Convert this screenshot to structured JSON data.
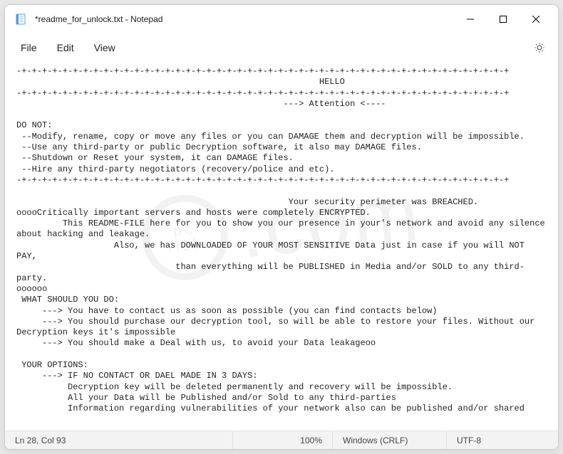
{
  "titlebar": {
    "title": "*readme_for_unlock.txt - Notepad"
  },
  "menu": {
    "file": "File",
    "edit": "Edit",
    "view": "View"
  },
  "status": {
    "pos": "Ln 28, Col 93",
    "zoom": "100%",
    "crlf": "Windows (CRLF)",
    "enc": "UTF-8"
  },
  "content": "-+-+-+-+-+-+-+-+-+-+-+-+-+-+-+-+-+-+-+-+-+-+-+-+-+-+-+-+-+-+-+-+-+-+-+-+-+-+-+-+-+-+-+-+-+-+-+-+\n                                                           HELLO\n-+-+-+-+-+-+-+-+-+-+-+-+-+-+-+-+-+-+-+-+-+-+-+-+-+-+-+-+-+-+-+-+-+-+-+-+-+-+-+-+-+-+-+-+-+-+-+-+\n                                                    ---> Attention <----\n\nDO NOT:\n --Modify, rename, copy or move any files or you can DAMAGE them and decryption will be impossible.\n --Use any third-party or public Decryption software, it also may DAMAGE files.\n --Shutdown or Reset your system, it can DAMAGE files.\n --Hire any third-party negotiators (recovery/police and etc).\n-+-+-+-+-+-+-+-+-+-+-+-+-+-+-+-+-+-+-+-+-+-+-+-+-+-+-+-+-+-+-+-+-+-+-+-+-+-+-+-+-+-+-+-+-+-+-+-+\n\n                                                     Your security perimeter was BREACHED.\nooooCritically important servers and hosts were completely ENCRYPTED.\n         This README-FILE here for you to show you our presence in your's network and avoid any silence about hacking and leakage.\n                   Also, we has DOWNLOADED OF YOUR MOST SENSITIVE Data just in case if you will NOT PAY,\n                               than everything will be PUBLISHED in Media and/or SOLD to any third-party.\noooooo\n WHAT SHOULD YOU DO:\n     ---> You have to contact us as soon as possible (you can find contacts below)\n     ---> You should purchase our decryption tool, so will be able to restore your files. Without our Decryption keys it's impossible\n     ---> You should make a Deal with us, to avoid your Data leakageoo\n\n YOUR OPTIONS:\n     ---> IF NO CONTACT OR DAEL MADE IN 3 DAYS:\n          Decryption key will be deleted permanently and recovery will be impossible.\n          All your Data will be Published and/or Sold to any third-parties\n          Information regarding vulnerabilities of your network also can be published and/or shared"
}
